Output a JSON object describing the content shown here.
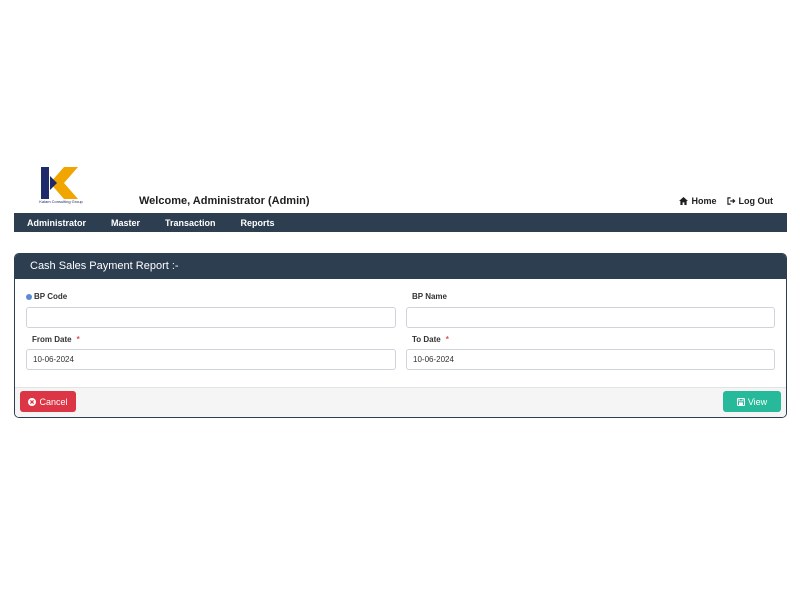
{
  "header": {
    "logo_text": "Kalam Consulting Group",
    "welcome": "Welcome,  Administrator (Admin)",
    "links": [
      {
        "label": "Home",
        "icon": "home-icon"
      },
      {
        "label": "Log Out",
        "icon": "logout-icon"
      }
    ]
  },
  "nav": {
    "items": [
      {
        "label": "Administrator"
      },
      {
        "label": "Master"
      },
      {
        "label": "Transaction"
      },
      {
        "label": "Reports"
      }
    ]
  },
  "panel": {
    "title": "Cash Sales Payment Report :-",
    "bp_code": {
      "label": "BP Code",
      "value": ""
    },
    "bp_name": {
      "label": "BP Name",
      "value": ""
    },
    "from_date": {
      "label": "From Date",
      "required": "*",
      "value": "10-06-2024"
    },
    "to_date": {
      "label": "To Date",
      "required": "*",
      "value": "10-06-2024"
    },
    "cancel_label": "Cancel",
    "view_label": "View"
  },
  "colors": {
    "nav_bg": "#2c3e50",
    "cancel": "#dc3545",
    "view": "#26b99a",
    "logo_navy": "#1f2a6b",
    "logo_orange": "#f0a500"
  }
}
